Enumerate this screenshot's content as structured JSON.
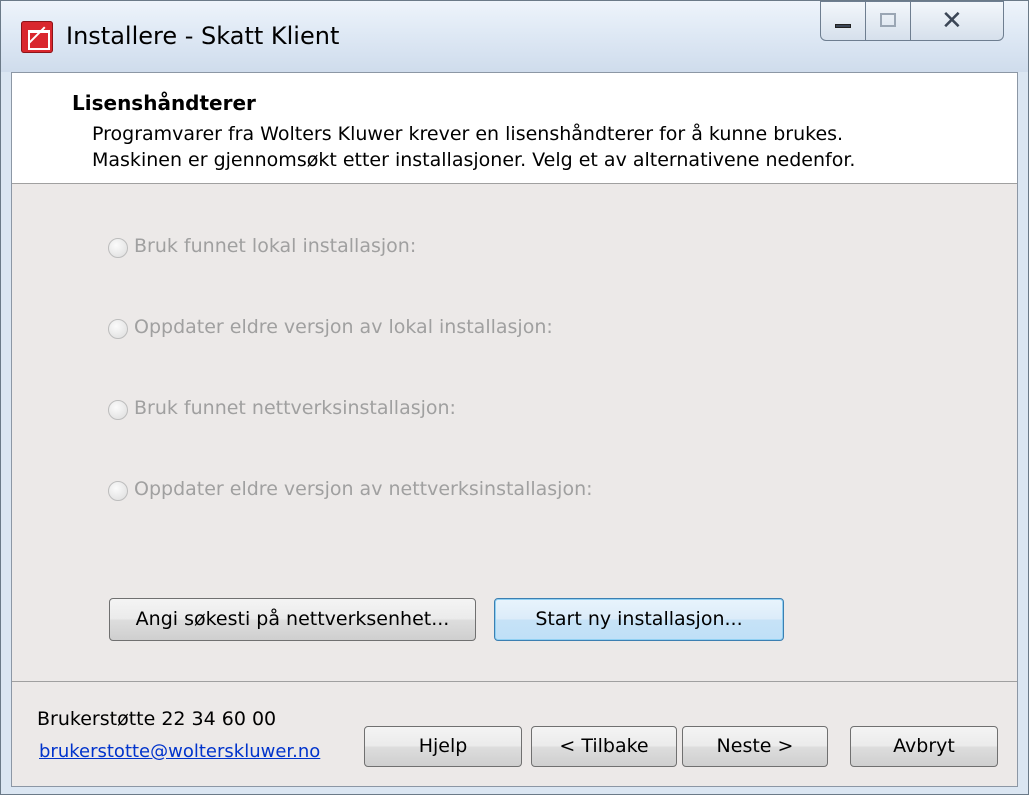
{
  "window": {
    "title": "Installere - Skatt Klient",
    "controls": [
      "minimize-icon",
      "maximize-icon",
      "close-icon"
    ]
  },
  "header": {
    "title": "Lisenshåndterer",
    "line1": "Programvarer fra Wolters Kluwer krever en lisenshåndterer for å kunne brukes.",
    "line2": "Maskinen er gjennomsøkt etter installasjoner. Velg et av alternativene nedenfor."
  },
  "options": [
    {
      "label": "Bruk funnet lokal installasjon:",
      "enabled": false,
      "selected": false
    },
    {
      "label": "Oppdater eldre versjon av lokal installasjon:",
      "enabled": false,
      "selected": false
    },
    {
      "label": "Bruk funnet nettverksinstallasjon:",
      "enabled": false,
      "selected": false
    },
    {
      "label": "Oppdater eldre versjon av nettverksinstallasjon:",
      "enabled": false,
      "selected": false
    }
  ],
  "actions": {
    "search_path": "Angi søkesti på nettverksenhet...",
    "new_install": "Start ny installasjon..."
  },
  "footer": {
    "support_phone": "Brukerstøtte 22 34 60 00",
    "support_email": "brukerstotte@wolterskluwer.no",
    "help": "Hjelp",
    "back": "< Tilbake",
    "next": "Neste >",
    "cancel": "Avbryt"
  },
  "colors": {
    "disabled_text": "#a0a0a0",
    "link": "#0033cc",
    "app_icon": "#d9272e"
  }
}
